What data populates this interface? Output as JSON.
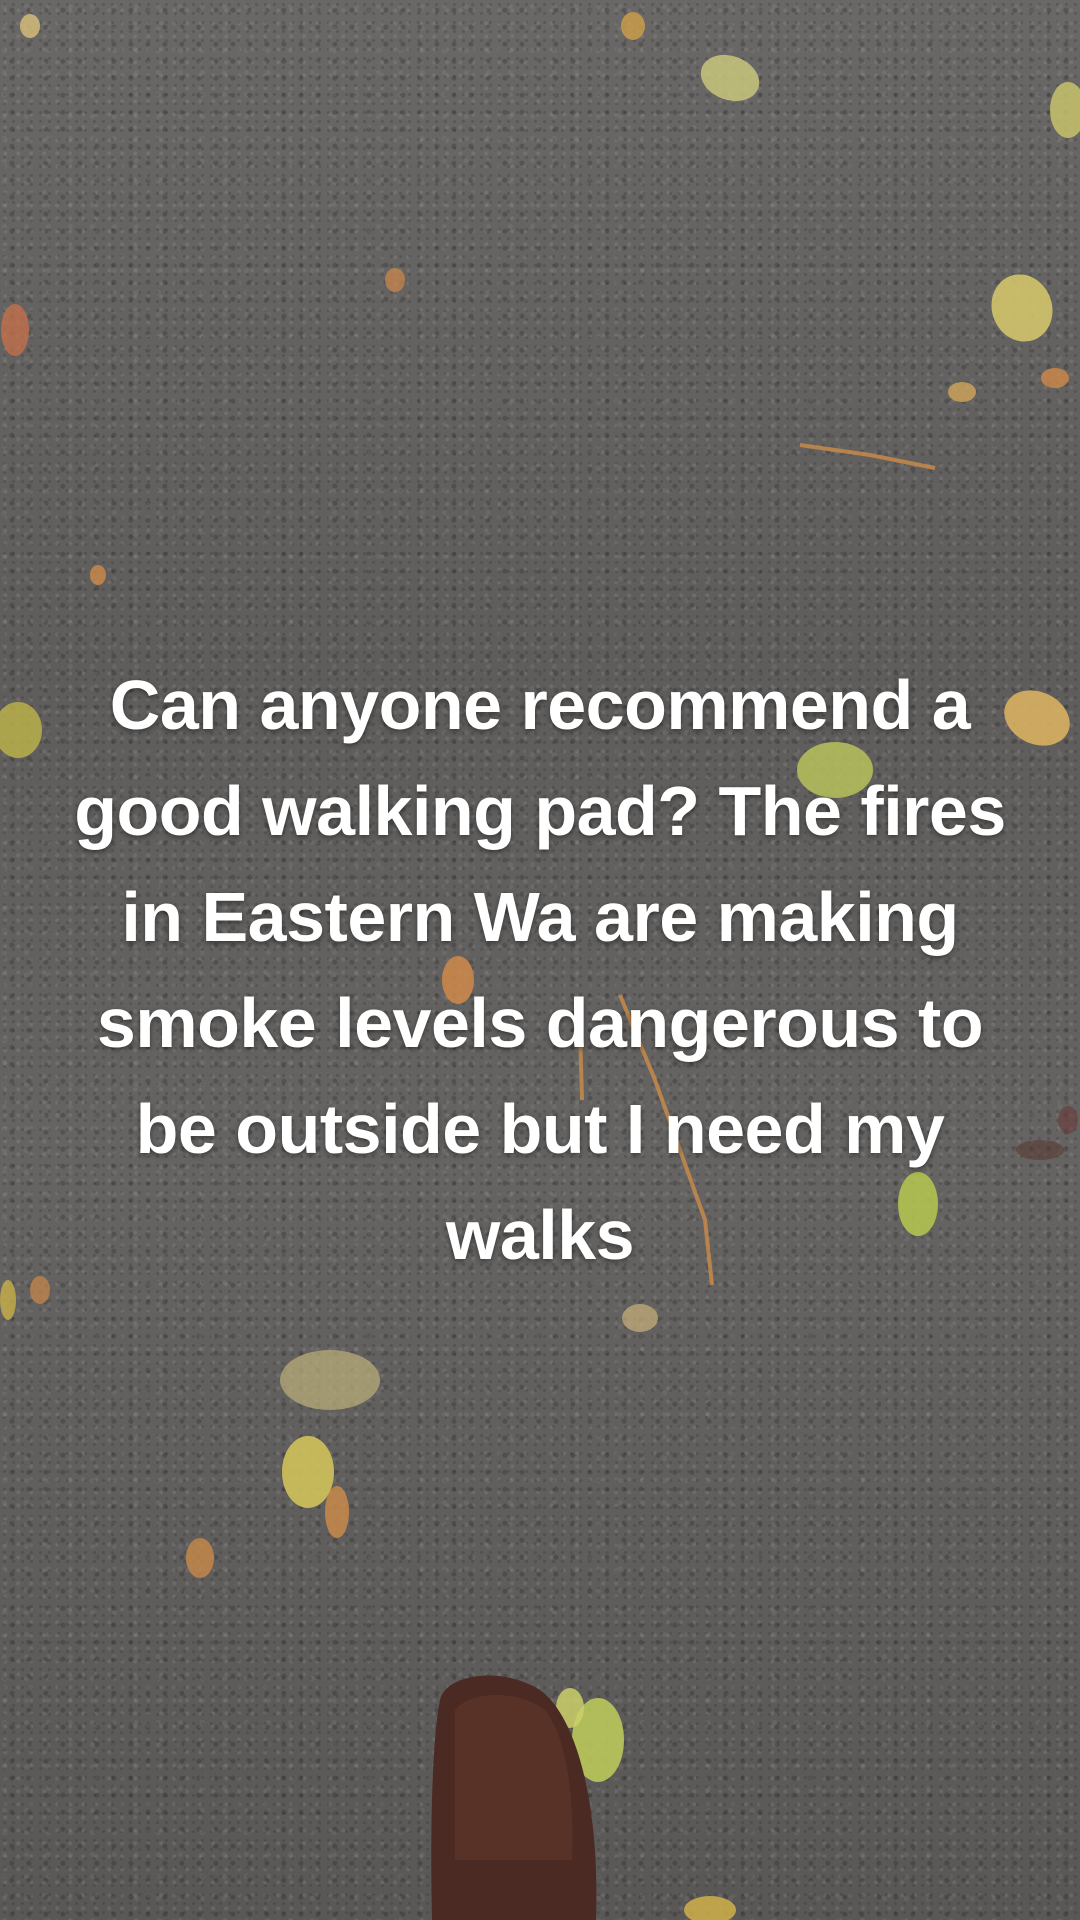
{
  "caption": {
    "text": "Can anyone recommend a good walking pad? The fires in Eastern Wa are making smoke levels dangerous to be outside but I need my walks"
  },
  "photo": {
    "colors": {
      "pavement": "#5f5d5b",
      "leaf_yellow": "#c9c25a",
      "leaf_green": "#b3c251",
      "leaf_orange": "#d0894a",
      "shoe": "#4a2a22"
    }
  }
}
